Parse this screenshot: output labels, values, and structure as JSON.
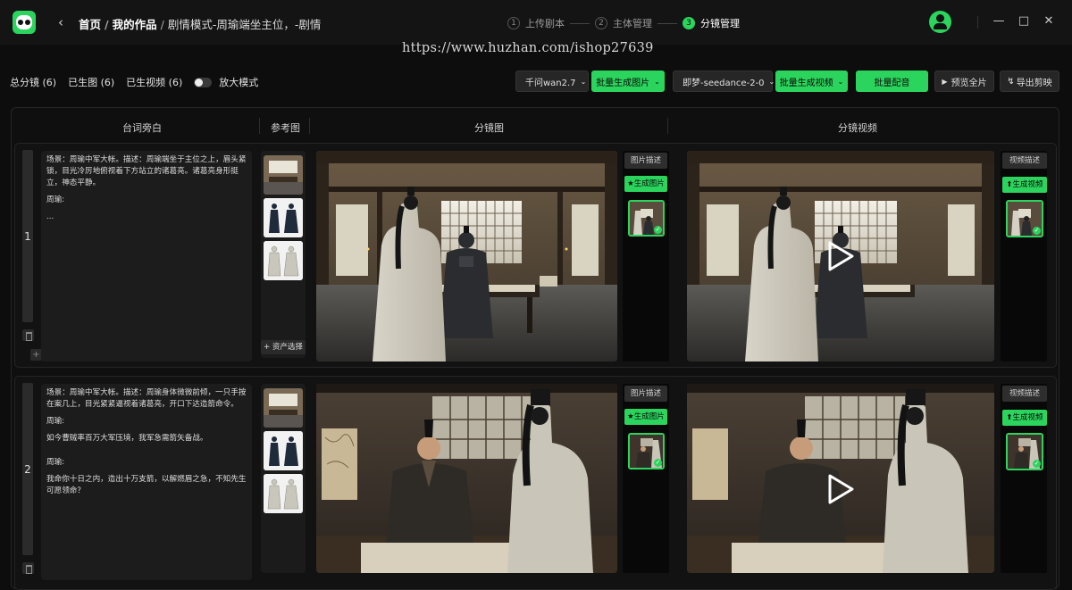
{
  "app": {
    "logo_icon": "panda-logo-icon",
    "accent": "#2bd45c"
  },
  "breadcrumb": {
    "home": "首页",
    "works": "我的作品",
    "current": "剧情模式-周瑜端坐主位，-剧情"
  },
  "steps": [
    {
      "num": "1",
      "label": "上传剧本"
    },
    {
      "num": "2",
      "label": "主体管理"
    },
    {
      "num": "3",
      "label": "分镜管理"
    }
  ],
  "watermark": "https://www.huzhan.com/ishop27639",
  "counts": {
    "total": "总分镜 (6)",
    "images": "已生图 (6)",
    "videos": "已生视频 (6)",
    "zoom": "放大模式"
  },
  "toolbar": {
    "image_model": "千问wan2.7",
    "batch_image": "批量生成图片",
    "video_model": "即梦-seedance-2-0",
    "batch_video": "批量生成视频",
    "batch_dub": "批量配音",
    "preview_all": "预览全片",
    "export": "导出剪映"
  },
  "columns": {
    "dialogue": "台词旁白",
    "reference": "参考图",
    "storyboard": "分镜图",
    "video": "分镜视频"
  },
  "rows": [
    {
      "index": "1",
      "dialogue": [
        "场景：周瑜中军大帐。描述：周瑜端坐于主位之上，眉头紧锁，目光冷厉地俯视着下方站立的诸葛亮。诸葛亮身形挺立，神态平静。",
        "周瑜:",
        "..."
      ],
      "asset_select": "+ 资产选择",
      "image_desc": "图片描述",
      "gen_image": "生成图片",
      "video_desc": "视频描述",
      "gen_video": "生成视频"
    },
    {
      "index": "2",
      "dialogue": [
        "场景：周瑜中军大帐。描述：周瑜身体微微前倾，一只手按在案几上，目光紧紧逼视着诸葛亮，开口下达造箭命令。",
        "周瑜:",
        "如今曹贼率百万大军压境，我军急需箭矢备战。",
        "周瑜:",
        "我命你十日之内，造出十万支箭，以解燃眉之急，不知先生可愿领命？"
      ],
      "image_desc": "图片描述",
      "gen_image": "生成图片",
      "video_desc": "视频描述",
      "gen_video": "生成视频"
    }
  ]
}
